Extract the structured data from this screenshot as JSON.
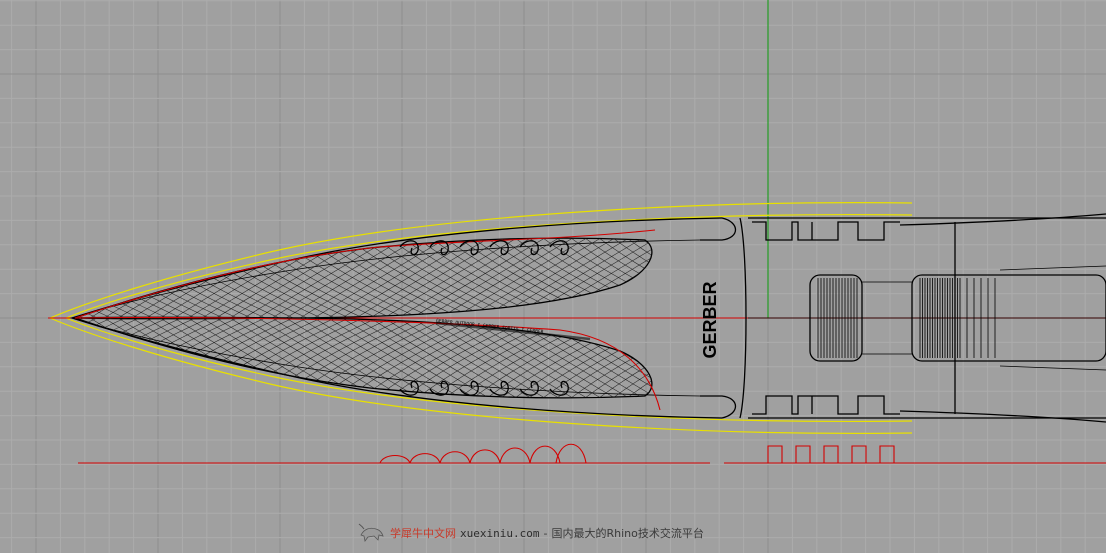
{
  "viewport": {
    "name": "Rhino top viewport",
    "background_color": "#a0a0a0",
    "grid_minor_color": "#acacac",
    "grid_major_color": "#8e8e8e",
    "axis_y_color": "#2e9e2e",
    "curve_colors": {
      "outline": "#000000",
      "offset": "#e8e000",
      "guide": "#d40000"
    }
  },
  "model": {
    "logo_text": "GERBER",
    "spine_engraving": "GERBER OUTDOOR I GERBER FORTIS I GERBER"
  },
  "watermark": {
    "logo_icon": "ox-logo-icon",
    "brand_cn": "学犀牛中文网",
    "domain": "xuexiniu.com",
    "separator": "-",
    "tagline": "国内最大的Rhino技术交流平台"
  }
}
